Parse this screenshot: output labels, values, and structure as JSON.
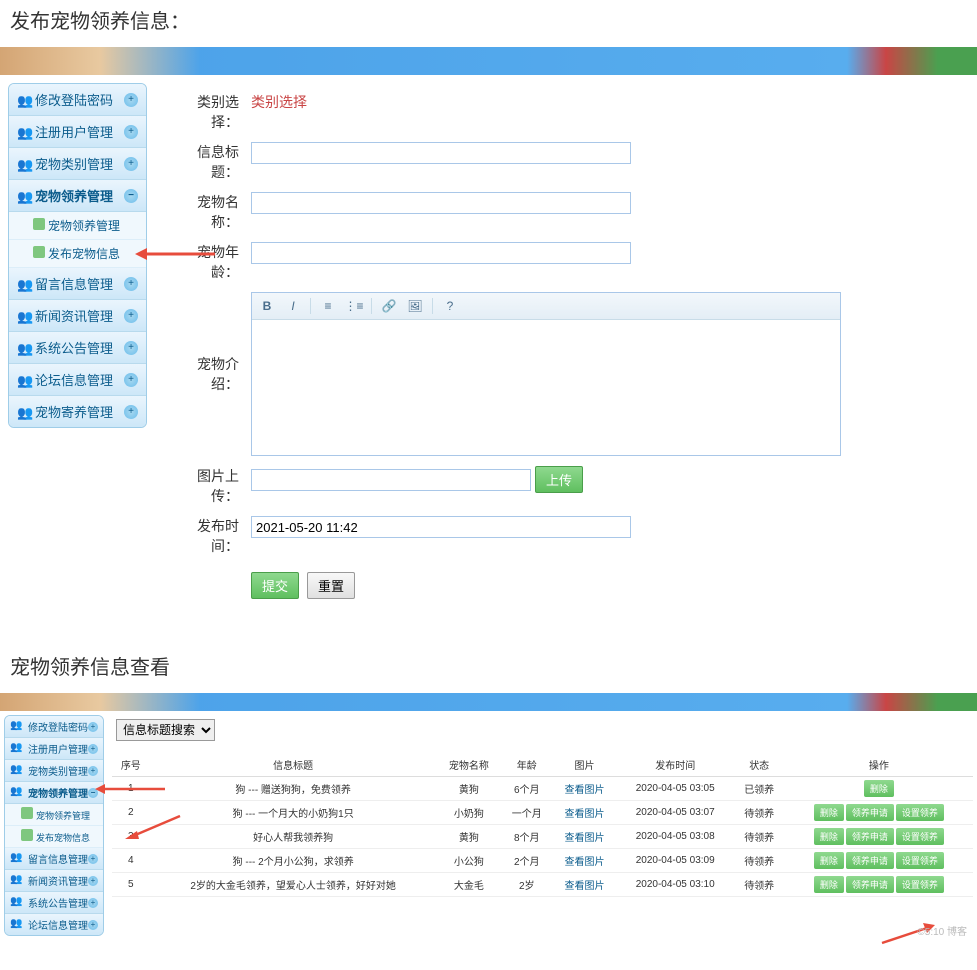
{
  "section1": {
    "title": "发布宠物领养信息：",
    "sidebar": {
      "items": [
        {
          "label": "修改登陆密码",
          "expanded": false
        },
        {
          "label": "注册用户管理",
          "expanded": false
        },
        {
          "label": "宠物类别管理",
          "expanded": false
        },
        {
          "label": "宠物领养管理",
          "expanded": true,
          "subs": [
            {
              "label": "宠物领养管理"
            },
            {
              "label": "发布宠物信息"
            }
          ]
        },
        {
          "label": "留言信息管理",
          "expanded": false
        },
        {
          "label": "新闻资讯管理",
          "expanded": false
        },
        {
          "label": "系统公告管理",
          "expanded": false
        },
        {
          "label": "论坛信息管理",
          "expanded": false
        },
        {
          "label": "宠物寄养管理",
          "expanded": false
        }
      ]
    },
    "form": {
      "category": {
        "label": "类别选择：",
        "value": "类别选择"
      },
      "title": {
        "label": "信息标题："
      },
      "pet_name": {
        "label": "宠物名称："
      },
      "pet_age": {
        "label": "宠物年龄："
      },
      "intro": {
        "label": "宠物介绍："
      },
      "upload": {
        "label": "图片上传：",
        "btn": "上传"
      },
      "pub_time": {
        "label": "发布时间：",
        "value": "2021-05-20 11:42"
      },
      "submit": "提交",
      "reset": "重置"
    }
  },
  "section2": {
    "title": "宠物领养信息查看",
    "sidebar": {
      "items": [
        {
          "label": "修改登陆密码",
          "expanded": false
        },
        {
          "label": "注册用户管理",
          "expanded": false
        },
        {
          "label": "宠物类别管理",
          "expanded": false
        },
        {
          "label": "宠物领养管理",
          "expanded": true,
          "subs": [
            {
              "label": "宠物领养管理"
            },
            {
              "label": "发布宠物信息"
            }
          ]
        },
        {
          "label": "留言信息管理",
          "expanded": false
        },
        {
          "label": "新闻资讯管理",
          "expanded": false
        },
        {
          "label": "系统公告管理",
          "expanded": false
        },
        {
          "label": "论坛信息管理",
          "expanded": false
        }
      ]
    },
    "search_label": "信息标题搜索",
    "table": {
      "headers": [
        "序号",
        "信息标题",
        "宠物名称",
        "年龄",
        "图片",
        "发布时间",
        "状态",
        "操作"
      ],
      "rows": [
        {
          "idx": "1",
          "title": "狗 --- 赠送狗狗，免费领养",
          "name": "黄狗",
          "age": "6个月",
          "img": "查看图片",
          "time": "2020-04-05 03:05",
          "status": "已领养",
          "ops": [
            "删除"
          ]
        },
        {
          "idx": "2",
          "title": "狗 --- 一个月大的小奶狗1只",
          "name": "小奶狗",
          "age": "一个月",
          "img": "查看图片",
          "time": "2020-04-05 03:07",
          "status": "待领养",
          "ops": [
            "删除",
            "领养申请",
            "设置领养"
          ]
        },
        {
          "idx": "3",
          "title": "好心人帮我领养狗",
          "name": "黄狗",
          "age": "8个月",
          "img": "查看图片",
          "time": "2020-04-05 03:08",
          "status": "待领养",
          "ops": [
            "删除",
            "领养申请",
            "设置领养"
          ]
        },
        {
          "idx": "4",
          "title": "狗 --- 2个月小公狗，求领养",
          "name": "小公狗",
          "age": "2个月",
          "img": "查看图片",
          "time": "2020-04-05 03:09",
          "status": "待领养",
          "ops": [
            "删除",
            "领养申请",
            "设置领养"
          ]
        },
        {
          "idx": "5",
          "title": "2岁的大金毛领养，望爱心人士领养，好好对她",
          "name": "大金毛",
          "age": "2岁",
          "img": "查看图片",
          "time": "2020-04-05 03:10",
          "status": "待领养",
          "ops": [
            "删除",
            "领养申请",
            "设置领养"
          ]
        }
      ]
    }
  }
}
